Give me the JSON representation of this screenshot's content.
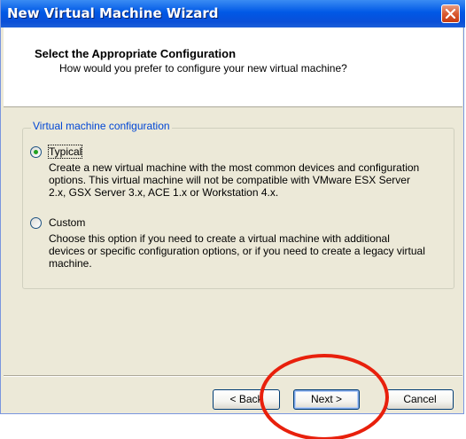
{
  "window": {
    "title": "New Virtual Machine Wizard"
  },
  "header": {
    "title": "Select the Appropriate Configuration",
    "subtitle": "How would you prefer to configure your new virtual machine?"
  },
  "group": {
    "legend": "Virtual machine configuration",
    "options": [
      {
        "label": "Typical",
        "selected": true,
        "description": [
          "Create a new virtual machine with the most common devices and configuration",
          "options. This virtual machine will not be compatible with VMware ESX Server",
          "2.x, GSX Server 3.x, ACE 1.x or Workstation 4.x."
        ]
      },
      {
        "label": "Custom",
        "selected": false,
        "description": [
          "Choose this option if you need to create a virtual machine with additional",
          "devices or specific configuration options, or if you need to create a legacy virtual",
          "machine."
        ]
      }
    ]
  },
  "buttons": {
    "back": "< Back",
    "next": "Next >",
    "cancel": "Cancel"
  },
  "colors": {
    "titlebar": "#0058e6",
    "legend_text": "#0046d5",
    "annotation_circle": "#e8200c"
  }
}
